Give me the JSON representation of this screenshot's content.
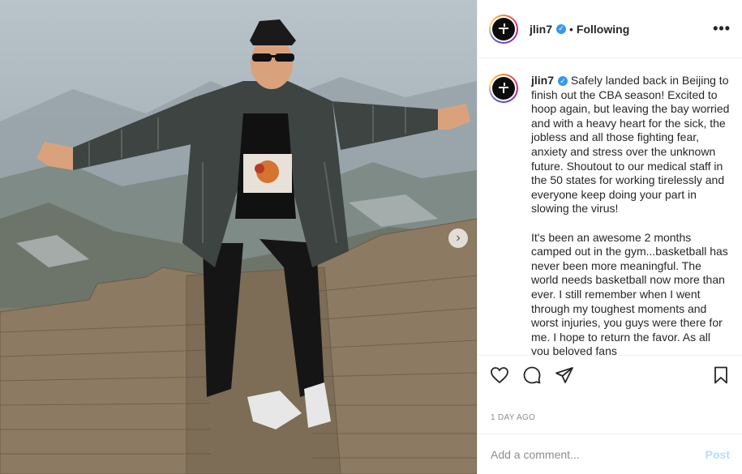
{
  "post": {
    "username": "jlin7",
    "verified_icon": "verified-badge-icon",
    "separator": "•",
    "follow_status": "Following",
    "more_label": "•••",
    "caption": "Safely landed back in Beijing to finish out the CBA season! Excited to hoop again, but leaving the bay worried and with a heavy heart for the sick, the jobless and all those fighting fear, anxiety and stress over the unknown future. Shoutout to our medical staff in the 50 states for working tirelessly and everyone keep doing your part in slowing the virus!\n\nIt's been an awesome 2 months camped out in the gym...basketball has never been more meaningful. The world needs basketball now more than ever. I still remember when I went through my toughest moments and worst injuries, you guys were there for me. I hope to return the favor. As all you beloved fans",
    "timestamp": "1 DAY AGO",
    "carousel_next": "›"
  },
  "actions": {
    "like": "heart-icon",
    "comment": "comment-icon",
    "share": "share-icon",
    "save": "bookmark-icon"
  },
  "comment_box": {
    "placeholder": "Add a comment...",
    "post_label": "Post"
  },
  "colors": {
    "verified": "#3897f0",
    "post_disabled": "#b2dffc",
    "muted": "#8e8e8e"
  }
}
